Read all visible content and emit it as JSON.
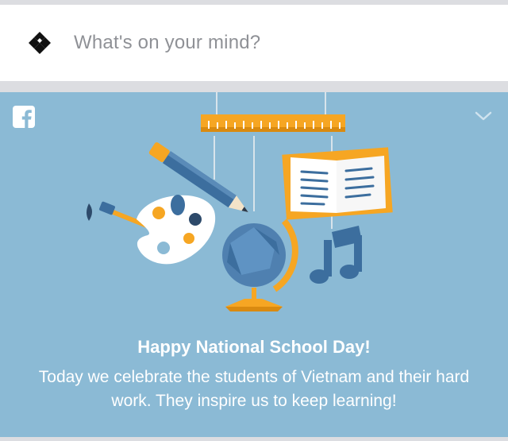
{
  "composer": {
    "placeholder": "What's on your mind?",
    "avatar_icon": "diamond-logo-icon"
  },
  "card": {
    "brand_icon": "facebook-icon",
    "menu_icon": "chevron-down-icon",
    "background_color": "#8bbad5",
    "title": "Happy National School Day!",
    "message": "Today we celebrate the students of Vietnam and their hard work. They inspire us to keep learning!",
    "illustration_items": [
      "ruler-icon",
      "pencil-icon",
      "book-icon",
      "paintbrush-icon",
      "palette-icon",
      "globe-icon",
      "music-note-icon"
    ]
  }
}
